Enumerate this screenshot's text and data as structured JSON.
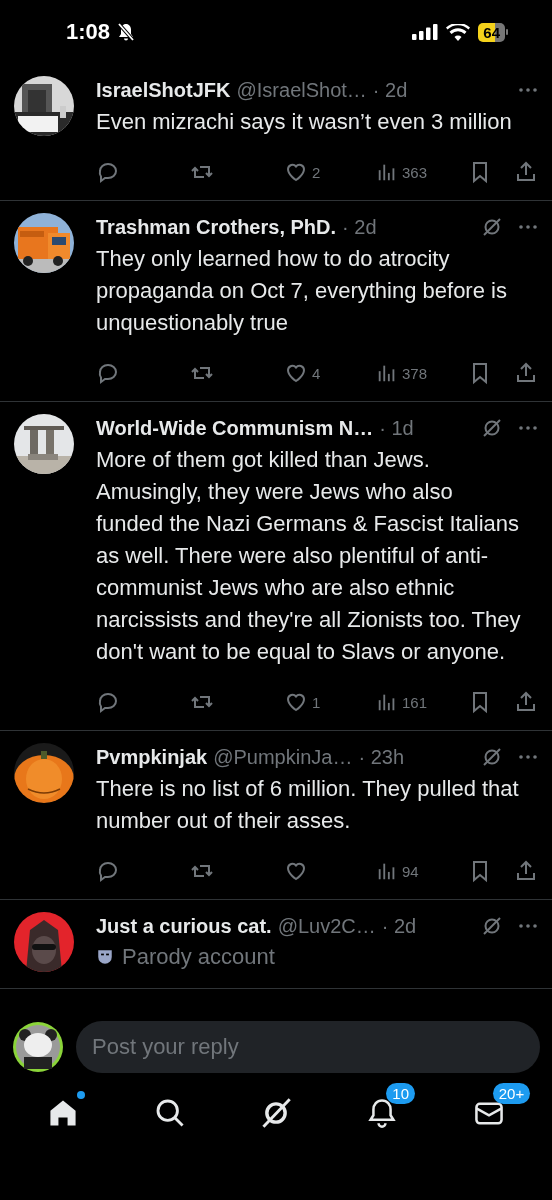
{
  "status_bar": {
    "time": "1:08",
    "battery": "64"
  },
  "posts": [
    {
      "name": "IsraelShotJFK",
      "handle": "@IsraelShot…",
      "time": "· 2d",
      "badge": false,
      "text": "Even mizrachi says it wasn’t even 3 million",
      "actions": {
        "likes": "2",
        "views": "363"
      }
    },
    {
      "name": "Trashman Crothers, PhD.",
      "time": "· 2d",
      "badge": true,
      "text": "They only learned how to do atrocity propaganda on Oct 7, everything before is unquestionably true",
      "actions": {
        "likes": "4",
        "views": "378"
      }
    },
    {
      "name": "World-Wide Communism N…",
      "time": "· 1d",
      "badge": true,
      "text": "More of them got killed than Jews. Amusingly, they were Jews who also funded the Nazi Germans & Fascist Italians as well. There were also plentiful of anti-communist Jews who are also ethnic narcissists and they're all Zionists too. They don't want to be equal to Slavs or anyone.",
      "actions": {
        "likes": "1",
        "views": "161"
      }
    },
    {
      "name": "Pvmpkinjak",
      "handle": "@PumpkinJa…",
      "time": "· 23h",
      "badge": true,
      "text": "There is no list of 6 million. They pulled that number out of their asses.",
      "actions": {
        "views": "94"
      }
    },
    {
      "name": "Just a curious cat.",
      "handle": "@Luv2C…",
      "time": "· 2d",
      "badge": true,
      "label": "Parody account"
    }
  ],
  "reply": {
    "placeholder": "Post your reply"
  },
  "nav": [
    {
      "kind": "home",
      "selected": true,
      "dot": true
    },
    {
      "kind": "search",
      "selected": false
    },
    {
      "kind": "grok",
      "selected": false
    },
    {
      "kind": "notifications",
      "selected": false,
      "badge": "10"
    },
    {
      "kind": "messages",
      "selected": false,
      "badge": "20+"
    }
  ]
}
